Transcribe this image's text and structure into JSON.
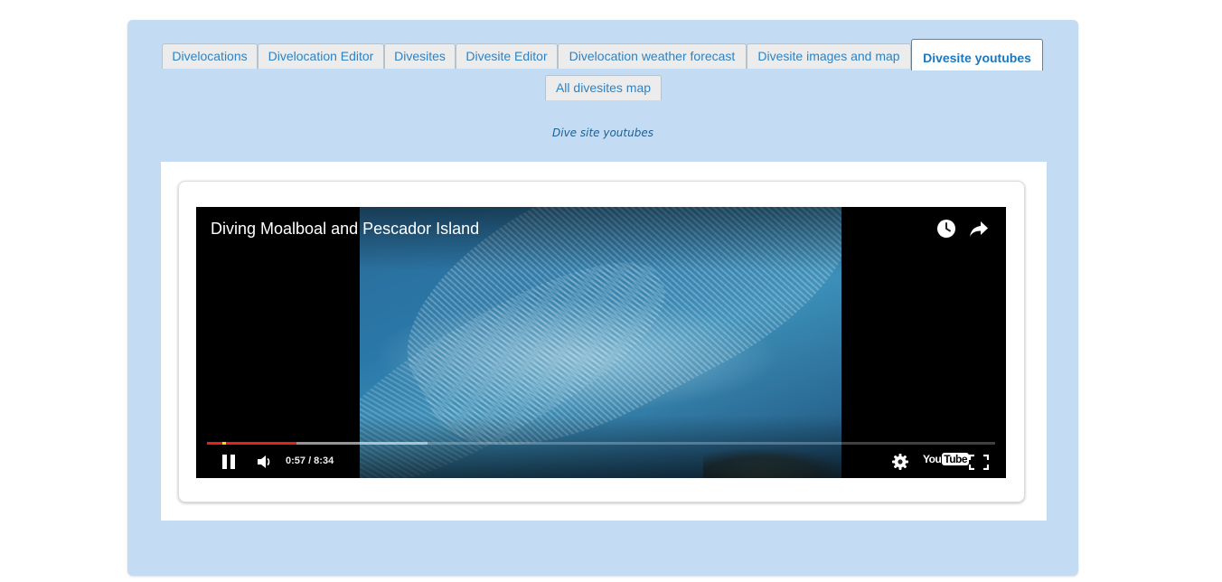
{
  "tabs": [
    {
      "label": "Divelocations",
      "active": false
    },
    {
      "label": "Divelocation Editor",
      "active": false
    },
    {
      "label": "Divesites",
      "active": false
    },
    {
      "label": "Divesite Editor",
      "active": false
    },
    {
      "label": "Divelocation weather forecast",
      "active": false
    },
    {
      "label": "Divesite images and map",
      "active": false
    },
    {
      "label": "Divesite youtubes",
      "active": true
    },
    {
      "label": "All divesites map",
      "active": false
    }
  ],
  "section_title": "Dive site youtubes",
  "video": {
    "title": "Diving Moalboal and Pescador Island",
    "time_display": "0:57 / 8:34",
    "played_fraction": 0.1139,
    "buffered_fraction": 0.28,
    "logo_you": "You",
    "logo_tube": "Tube"
  },
  "colors": {
    "panel_bg": "#c3dcf3",
    "tab_text": "#2d83c5",
    "progress_played": "#e62117"
  },
  "icons": [
    "watch-later-icon",
    "share-icon",
    "pause-icon",
    "volume-icon",
    "settings-gear-icon",
    "youtube-logo-icon",
    "fullscreen-icon"
  ]
}
